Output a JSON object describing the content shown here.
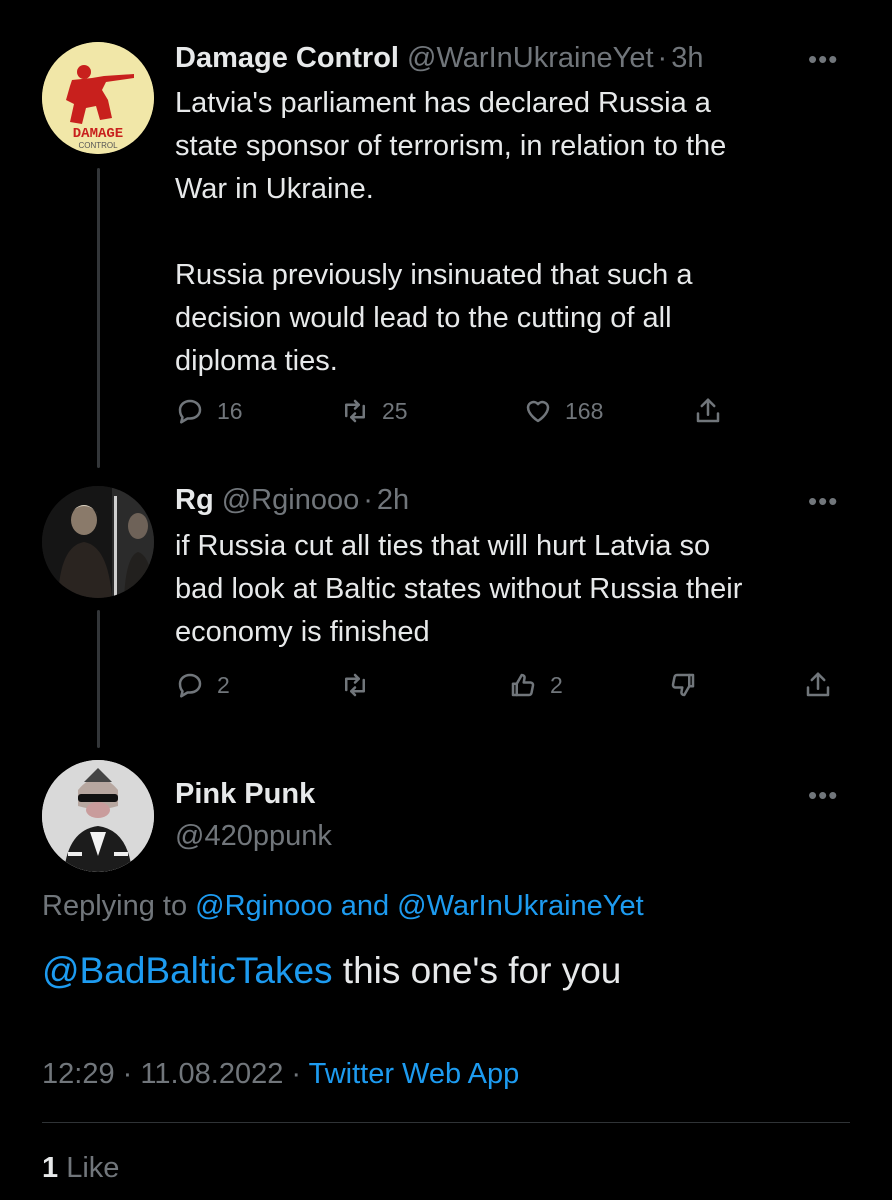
{
  "tweet1": {
    "name": "Damage Control",
    "handle": "@WarInUkraineYet",
    "sep": "·",
    "time": "3h",
    "avatar_text": "DAMAGE",
    "avatar_subtext": "CONTROL",
    "text": "Latvia's parliament has declared Russia a\nstate sponsor of terrorism, in relation to the\nWar in Ukraine.\n\nRussia previously insinuated that such a\ndecision would lead to the cutting of all\ndiploma ties.",
    "replies": "16",
    "retweets": "25",
    "likes": "168"
  },
  "tweet2": {
    "name": "Rg",
    "handle": "@Rginooo",
    "sep": "·",
    "time": "2h",
    "text": "if Russia cut all ties that will hurt Latvia so\nbad look at Baltic states without Russia their\neconomy is finished",
    "replies": "2",
    "upvotes": "2"
  },
  "tweet3": {
    "name": "Pink Punk",
    "handle": "@420ppunk",
    "replying_prefix": "Replying to",
    "replying_user1": "@Rginooo",
    "replying_and": "and",
    "replying_user2": "@WarInUkraineYet",
    "mention": "@BadBalticTakes",
    "body": " this one's for you",
    "timestamp": "12:29 · 11.08.2022 ·",
    "source": "Twitter Web App",
    "like_count": "1",
    "like_label": "Like"
  },
  "more_icon": "•••",
  "colors": {
    "background": "#000000",
    "text": "#e7e9ea",
    "muted": "#71767b",
    "link": "#1d9bf0"
  }
}
